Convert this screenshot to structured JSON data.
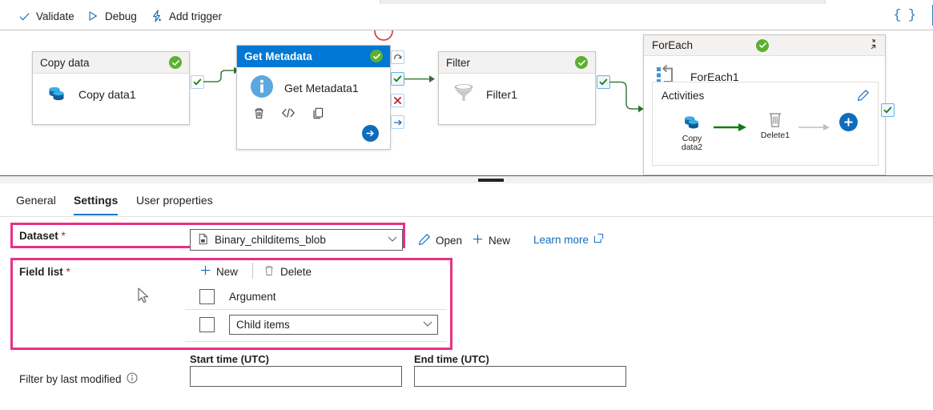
{
  "toolbar": {
    "validate": "Validate",
    "debug": "Debug",
    "add_trigger": "Add trigger",
    "code_icon": "code-braces-icon"
  },
  "canvas": {
    "nodes": [
      {
        "header": "Copy data",
        "name": "Copy data1",
        "icon": "copy-data-icon",
        "status": "succeeded",
        "selected": false
      },
      {
        "header": "Get Metadata",
        "name": "Get Metadata1",
        "icon": "get-metadata-info-icon",
        "status": "succeeded",
        "selected": true,
        "actions": [
          "delete-icon",
          "code-icon",
          "clone-icon",
          "run-icon"
        ]
      },
      {
        "header": "Filter",
        "name": "Filter1",
        "icon": "filter-funnel-icon",
        "status": "succeeded",
        "selected": false
      }
    ],
    "foreach": {
      "header": "ForEach",
      "name": "ForEach1",
      "icon": "foreach-loop-icon",
      "status": "succeeded",
      "expand_icon": "expand-icon",
      "activities_label": "Activities",
      "edit_icon": "pencil-icon",
      "inner": [
        {
          "label": "Copy data2",
          "icon": "copy-data-icon"
        },
        {
          "label": "Delete1",
          "icon": "delete-trash-icon"
        },
        {
          "label": "",
          "icon": "add-plus-icon"
        }
      ]
    },
    "connectors": {
      "success": "success-check-icon",
      "failure": "failure-x-icon",
      "completion": "completion-arrow-icon",
      "skipped": "skipped-retry-icon"
    }
  },
  "panel": {
    "tabs": [
      {
        "label": "General",
        "active": false
      },
      {
        "label": "Settings",
        "active": true
      },
      {
        "label": "User properties",
        "active": false
      }
    ],
    "dataset": {
      "label": "Dataset",
      "required": "*",
      "value": "Binary_childitems_blob",
      "value_icon": "dataset-file-icon",
      "open_label": "Open",
      "open_icon": "pencil-icon",
      "new_label": "New",
      "new_icon": "plus-icon",
      "learn_more_label": "Learn more",
      "learn_more_icon": "external-link-icon"
    },
    "field_list": {
      "label": "Field list",
      "required": "*",
      "new_label": "New",
      "new_icon": "plus-icon",
      "delete_label": "Delete",
      "delete_icon": "trash-icon",
      "rows": [
        {
          "type": "text",
          "value": "Argument",
          "checked": false
        },
        {
          "type": "combo",
          "value": "Child items",
          "checked": false
        }
      ]
    },
    "filter_modified": {
      "label": "Filter by last modified",
      "info_icon": "info-icon",
      "start_label": "Start time (UTC)",
      "start_value": "",
      "end_label": "End time (UTC)",
      "end_value": ""
    }
  },
  "colors": {
    "accent": "#0078d4",
    "highlight": "#e8308a",
    "success": "#5cb030",
    "error": "#a4262c"
  }
}
